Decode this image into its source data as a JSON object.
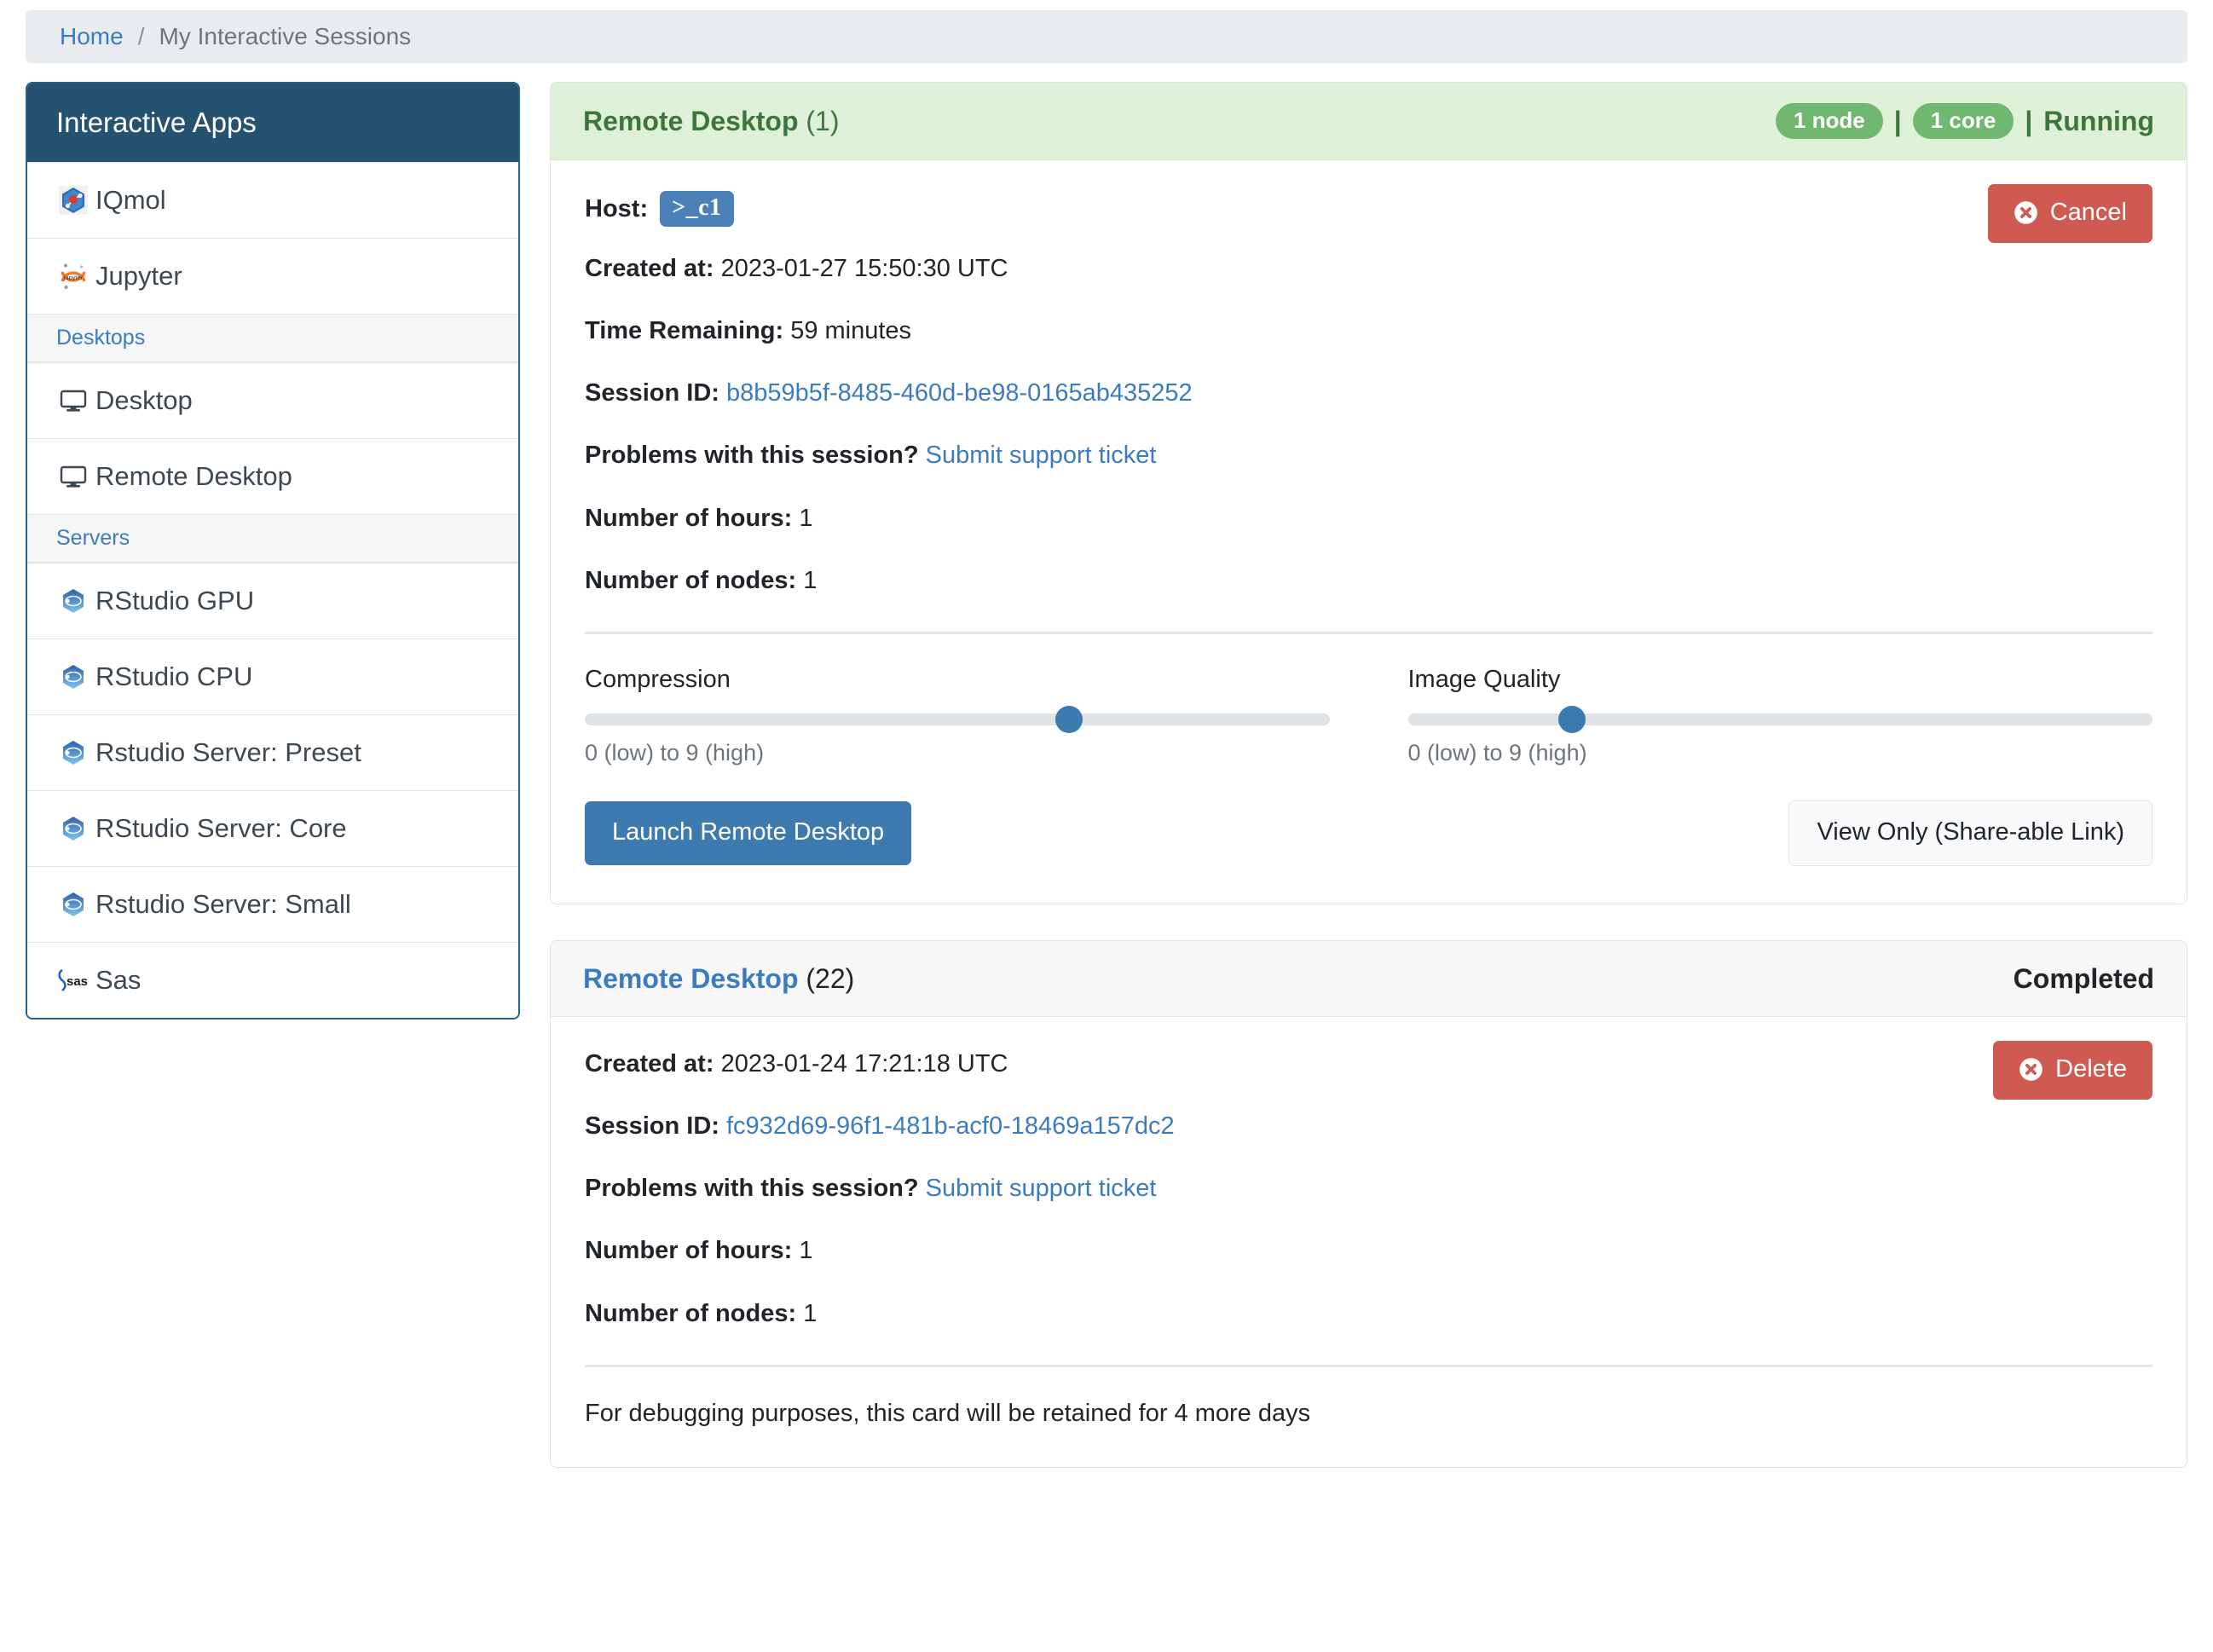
{
  "breadcrumb": {
    "home_label": "Home",
    "separator": "/",
    "current_label": "My Interactive Sessions"
  },
  "sidebar": {
    "header": "Interactive Apps",
    "items": [
      {
        "type": "app",
        "label": "IQmol",
        "icon": "iqmol-icon"
      },
      {
        "type": "app",
        "label": "Jupyter",
        "icon": "jupyter-icon"
      },
      {
        "type": "section",
        "label": "Desktops"
      },
      {
        "type": "app",
        "label": "Desktop",
        "icon": "monitor-icon"
      },
      {
        "type": "app",
        "label": "Remote Desktop",
        "icon": "monitor-icon"
      },
      {
        "type": "section",
        "label": "Servers"
      },
      {
        "type": "app",
        "label": "RStudio GPU",
        "icon": "rstudio-icon"
      },
      {
        "type": "app",
        "label": "RStudio CPU",
        "icon": "rstudio-icon"
      },
      {
        "type": "app",
        "label": "Rstudio Server: Preset",
        "icon": "rstudio-icon"
      },
      {
        "type": "app",
        "label": "RStudio Server: Core",
        "icon": "rstudio-icon"
      },
      {
        "type": "app",
        "label": "Rstudio Server: Small",
        "icon": "rstudio-icon"
      },
      {
        "type": "app",
        "label": "Sas",
        "icon": "sas-icon"
      }
    ]
  },
  "sessions": [
    {
      "title": "Remote Desktop",
      "count": "(1)",
      "status": "Running",
      "badges": [
        "1 node",
        "1 core"
      ],
      "pipe": "|",
      "host_label": "Host:",
      "host_value": "c1",
      "host_prompt": ">_",
      "created_label": "Created at:",
      "created_value": "2023-01-27 15:50:30 UTC",
      "time_remaining_label": "Time Remaining:",
      "time_remaining_value": "59 minutes",
      "session_id_label": "Session ID:",
      "session_id_value": "b8b59b5f-8485-460d-be98-0165ab435252",
      "problems_label": "Problems with this session?",
      "support_link": "Submit support ticket",
      "hours_label": "Number of hours:",
      "hours_value": "1",
      "nodes_label": "Number of nodes:",
      "nodes_value": "1",
      "cancel_label": "Cancel",
      "compression": {
        "label": "Compression",
        "hint": "0 (low) to 9 (high)",
        "value_percent": 65
      },
      "image_quality": {
        "label": "Image Quality",
        "hint": "0 (low) to 9 (high)",
        "value_percent": 22
      },
      "launch_label": "Launch Remote Desktop",
      "view_only_label": "View Only (Share-able Link)"
    },
    {
      "title": "Remote Desktop",
      "count": "(22)",
      "status": "Completed",
      "created_label": "Created at:",
      "created_value": "2023-01-24 17:21:18 UTC",
      "session_id_label": "Session ID:",
      "session_id_value": "fc932d69-96f1-481b-acf0-18469a157dc2",
      "problems_label": "Problems with this session?",
      "support_link": "Submit support ticket",
      "hours_label": "Number of hours:",
      "hours_value": "1",
      "nodes_label": "Number of nodes:",
      "nodes_value": "1",
      "delete_label": "Delete",
      "debug_note": "For debugging purposes, this card will be retained for 4 more days"
    }
  ],
  "colors": {
    "sidebar_header_bg": "#255270",
    "running_header_bg": "#dff0d8",
    "running_text": "#3c763d",
    "badge_green": "#70b770",
    "link_blue": "#3b7cbf",
    "primary_blue": "#3d7ab0",
    "danger_red": "#cf5a52"
  }
}
